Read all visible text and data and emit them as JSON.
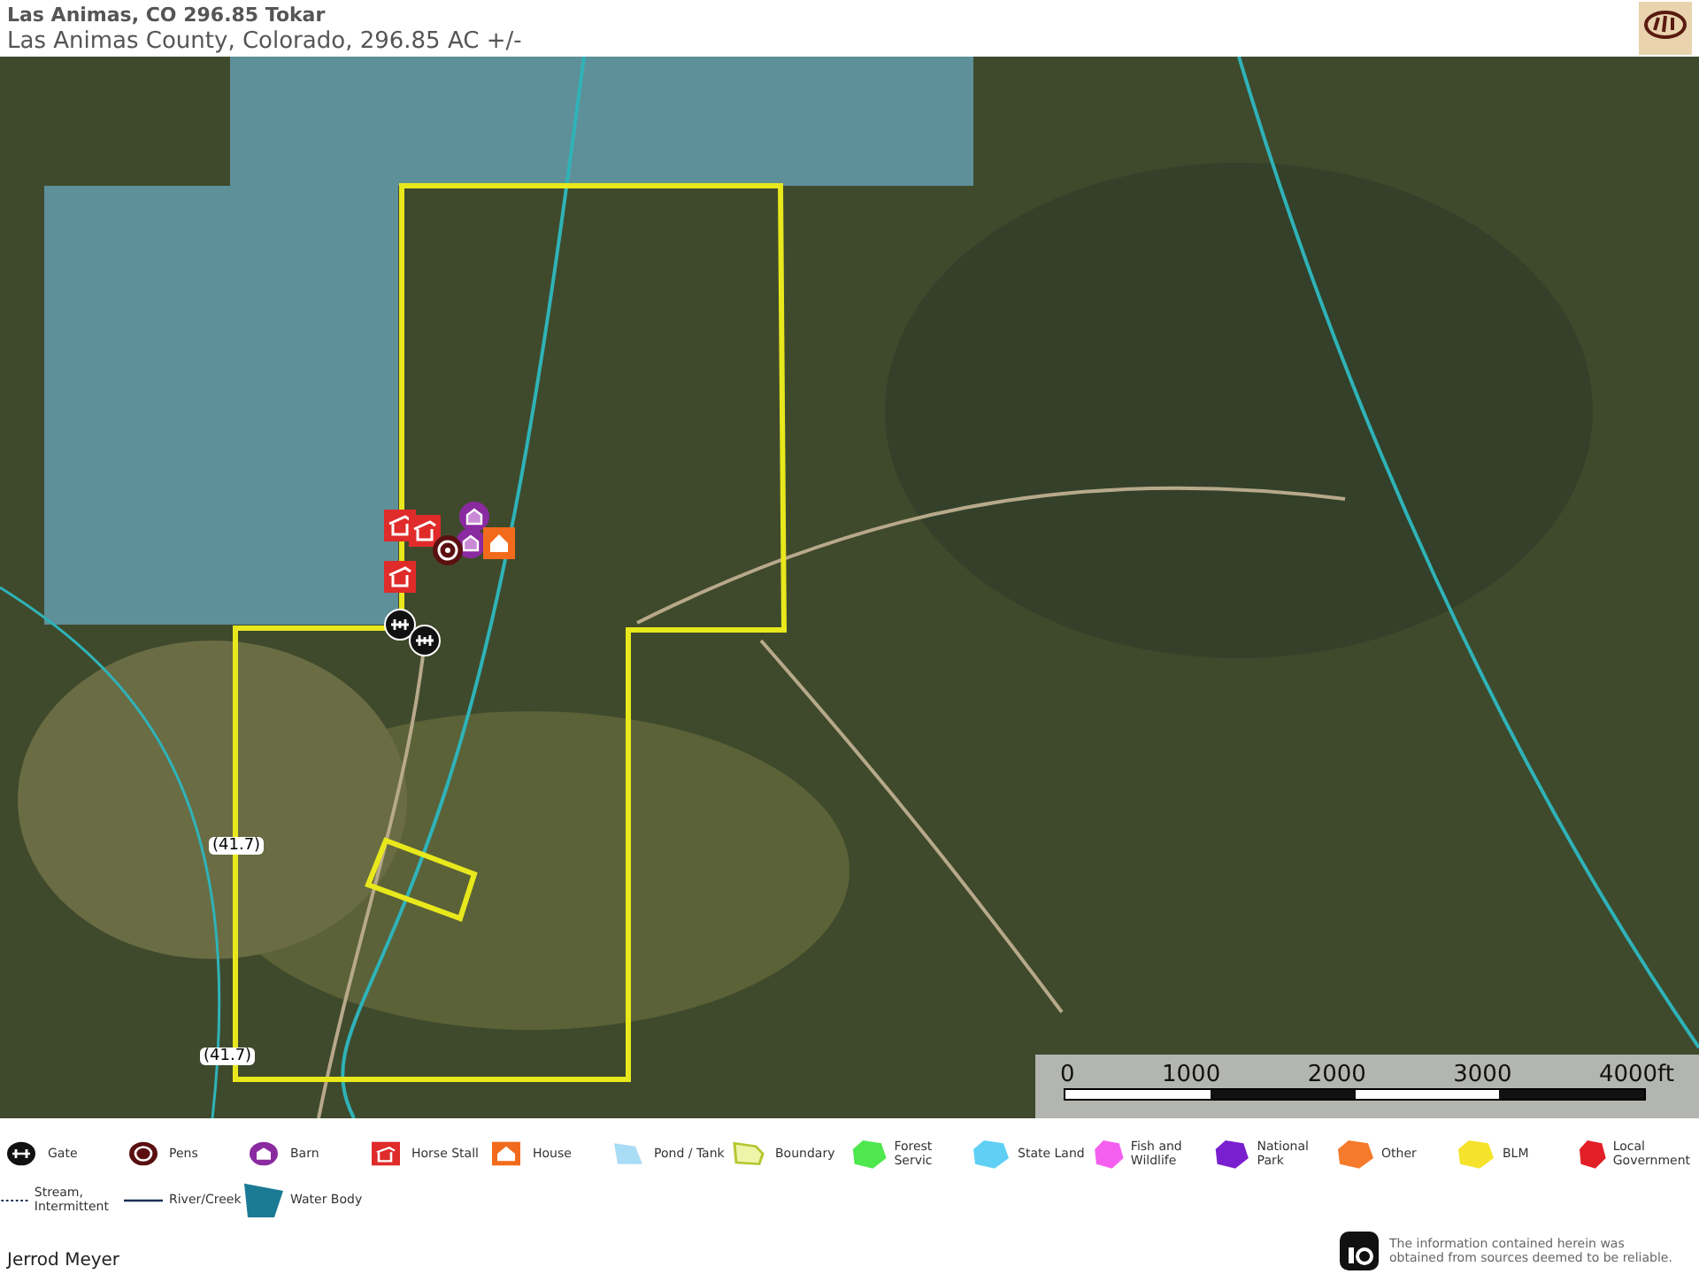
{
  "header": {
    "title": "Las Animas, CO 296.85 Tokar",
    "subtitle": "Las Animas County, Colorado, 296.85 AC +/-"
  },
  "map": {
    "markers": [
      {
        "kind": "horse_stall"
      },
      {
        "kind": "horse_stall"
      },
      {
        "kind": "horse_stall"
      },
      {
        "kind": "barn"
      },
      {
        "kind": "barn"
      },
      {
        "kind": "pens"
      },
      {
        "kind": "house"
      },
      {
        "kind": "gate"
      },
      {
        "kind": "gate"
      }
    ],
    "road_labels": [
      "(41.7)",
      "(41.7)"
    ],
    "scale_bar": {
      "ticks": [
        "0",
        "1000",
        "2000",
        "3000",
        "4000ft"
      ]
    }
  },
  "legend": [
    {
      "kind": "gate",
      "label": "Gate"
    },
    {
      "kind": "pens",
      "label": "Pens"
    },
    {
      "kind": "barn",
      "label": "Barn"
    },
    {
      "kind": "horse_stall",
      "label": "Horse Stall"
    },
    {
      "kind": "house",
      "label": "House"
    },
    {
      "kind": "pond",
      "label": "Pond / Tank"
    },
    {
      "kind": "boundary",
      "label": "Boundary"
    },
    {
      "kind": "area",
      "label": "Forest Servic",
      "color": "#4ee84e"
    },
    {
      "kind": "area",
      "label": "State Land",
      "color": "#5fcff5"
    },
    {
      "kind": "area",
      "label": "Fish and Wildlife",
      "color": "#f55ff0"
    },
    {
      "kind": "area",
      "label": "National Park",
      "color": "#7a1fcf"
    },
    {
      "kind": "area",
      "label": "Other",
      "color": "#f57a2b"
    },
    {
      "kind": "area",
      "label": "BLM",
      "color": "#f5e32b"
    },
    {
      "kind": "area",
      "label": "Local Government",
      "color": "#e21f26"
    },
    {
      "kind": "stream",
      "label": "Stream, Intermittent"
    },
    {
      "kind": "river",
      "label": "River/Creek"
    },
    {
      "kind": "water_body",
      "label": "Water Body"
    }
  ],
  "footer": {
    "agent": "Jerrod Meyer",
    "disclaimer": "The information contained herein was obtained from sources deemed to be reliable."
  }
}
